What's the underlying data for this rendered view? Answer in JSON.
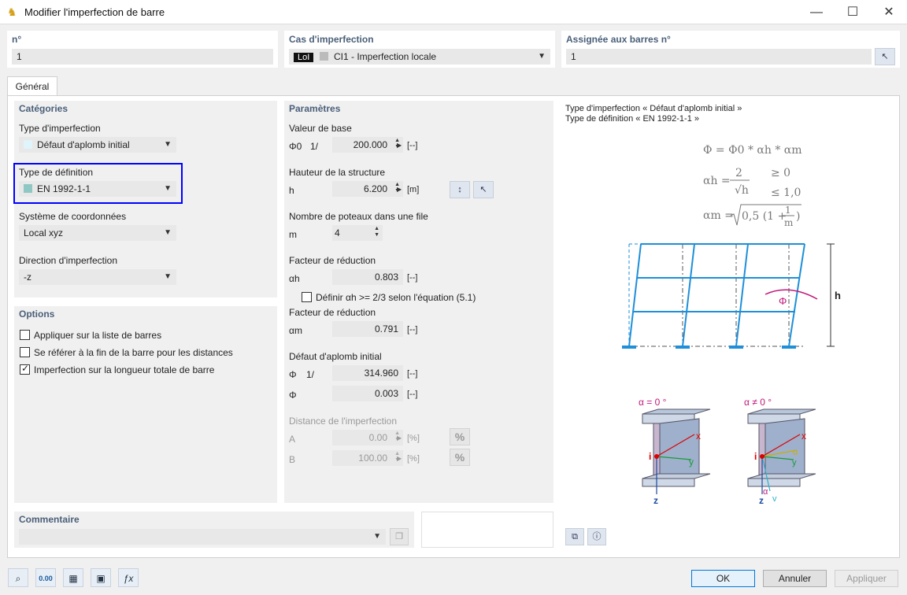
{
  "window": {
    "title": "Modifier l'imperfection de barre",
    "minimize": "—",
    "maximize": "☐",
    "close": "✕"
  },
  "header": {
    "n_label": "n°",
    "n_value": "1",
    "case_label": "Cas d'imperfection",
    "case_tag": "LoI",
    "case_value": "CI1 - Imperfection locale",
    "assigned_label": "Assignée aux barres n°",
    "assigned_value": "1"
  },
  "tabs": {
    "general": "Général"
  },
  "categories": {
    "title": "Catégories",
    "type_label": "Type d'imperfection",
    "type_value": "Défaut d'aplomb initial",
    "def_label": "Type de définition",
    "def_value": "EN 1992-1-1",
    "coord_label": "Système de coordonnées",
    "coord_value": "Local xyz",
    "dir_label": "Direction d'imperfection",
    "dir_value": "-z"
  },
  "options": {
    "title": "Options",
    "opt1": "Appliquer sur la liste de barres",
    "opt2": "Se référer à la fin de la barre pour les distances",
    "opt3": "Imperfection sur la longueur totale de barre",
    "opt1_checked": false,
    "opt2_checked": false,
    "opt3_checked": true
  },
  "params": {
    "title": "Paramètres",
    "base_label": "Valeur de base",
    "phi0_sym": "Φ0",
    "phi0_prefix": "1/",
    "phi0_value": "200.000",
    "phi0_unit": "[--]",
    "height_label": "Hauteur de la structure",
    "h_sym": "h",
    "h_value": "6.200",
    "h_unit": "[m]",
    "posts_label": "Nombre de poteaux dans une file",
    "m_sym": "m",
    "m_value": "4",
    "red1_label": "Facteur de réduction",
    "ah_sym": "αh",
    "ah_value": "0.803",
    "ah_unit": "[--]",
    "define_label": "Définir αh >= 2/3 selon l'équation (5.1)",
    "red2_label": "Facteur de réduction",
    "am_sym": "αm",
    "am_value": "0.791",
    "am_unit": "[--]",
    "defect_label": "Défaut d'aplomb initial",
    "phi_sym": "Φ",
    "phi_prefix": "1/",
    "phi_value": "314.960",
    "phi_unit": "[--]",
    "phi2_sym": "Φ",
    "phi2_value": "0.003",
    "phi2_unit": "[--]",
    "dist_label": "Distance de l'imperfection",
    "a_sym": "A",
    "a_value": "0.00",
    "a_unit": "[%]",
    "b_sym": "B",
    "b_value": "100.00",
    "b_unit": "[%]"
  },
  "diagram": {
    "line1": "Type d'imperfection « Défaut d'aplomb initial »",
    "line2": "Type de définition « EN 1992-1-1 »",
    "f1": "Φ = Φ0 * αh * αm",
    "f2a": "αh =",
    "f2num": "2",
    "f2den": "√h",
    "f2c1": "≥ 0",
    "f2c2": "≤ 1,0",
    "f3a": "αm =",
    "f3b": "0,5 (1 +",
    "f3num": "1",
    "f3den": "m",
    "f3c": ")",
    "phi": "Φ",
    "h": "h",
    "alpha0": "α = 0 °",
    "alphaN": "α ≠ 0 °",
    "i": "i",
    "x": "x",
    "y": "y",
    "z": "z",
    "u": "u",
    "v": "v",
    "alpha": "α"
  },
  "comment": {
    "label": "Commentaire"
  },
  "footer": {
    "ok": "OK",
    "cancel": "Annuler",
    "apply": "Appliquer"
  },
  "colors": {
    "accent": "#0078d7",
    "frame": "#1e8fd8",
    "highlight": "#0000ff",
    "alpha": "#c0187a"
  }
}
